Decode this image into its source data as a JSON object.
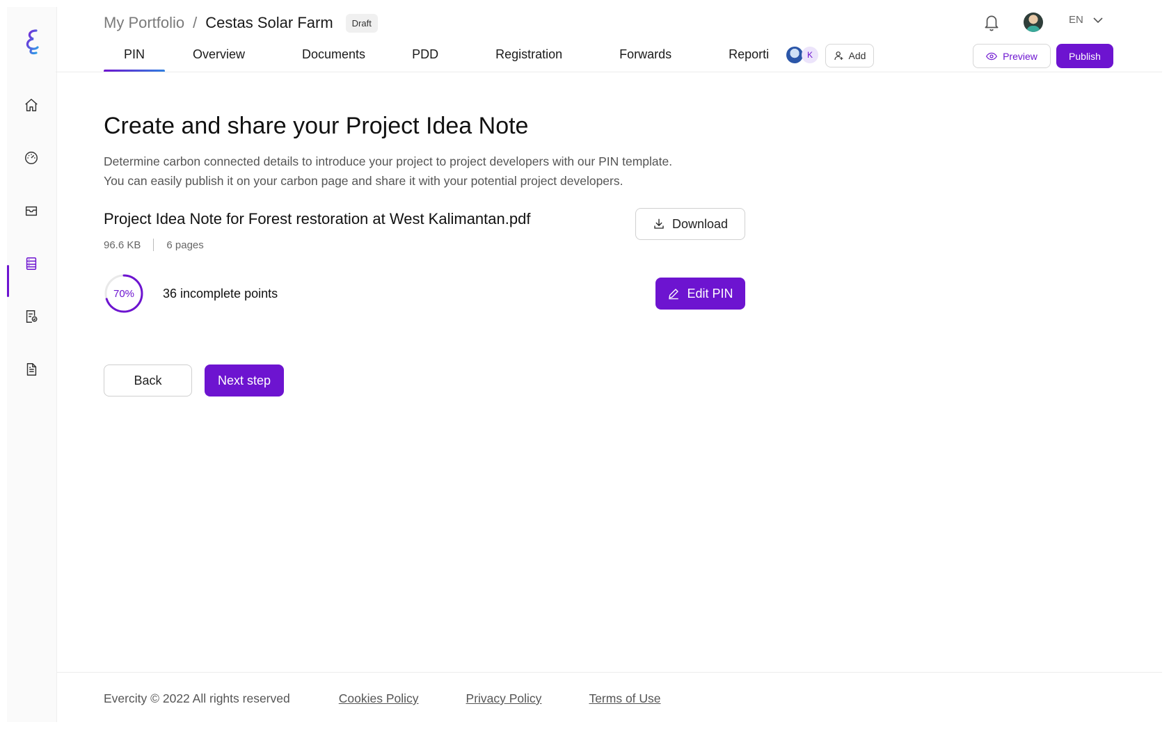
{
  "breadcrumb": {
    "root": "My Portfolio",
    "separator": "/",
    "current": "Cestas Solar Farm",
    "status": "Draft"
  },
  "header": {
    "language": "EN"
  },
  "tabs": [
    {
      "label": "PIN",
      "active": true
    },
    {
      "label": "Overview"
    },
    {
      "label": "Documents"
    },
    {
      "label": "PDD"
    },
    {
      "label": "Registration"
    },
    {
      "label": "Forwards"
    },
    {
      "label": "Reporti"
    }
  ],
  "collaborators": {
    "initial": "K",
    "add_label": "Add"
  },
  "actions": {
    "preview_label": "Preview",
    "publish_label": "Publish"
  },
  "main": {
    "title": "Create and share your Project Idea Note",
    "desc_line1": "Determine carbon connected details to introduce your project to project developers with our PIN template.",
    "desc_line2": "You can easily publish it on your carbon page and share it with your potential project developers.",
    "file": {
      "name": "Project Idea Note for Forest restoration at West Kalimantan.pdf",
      "size": "96.6 KB",
      "pages": "6 pages"
    },
    "download_label": "Download",
    "progress": {
      "percent": 70,
      "label": "70%"
    },
    "incomplete_text": "36 incomplete points",
    "edit_label": "Edit PIN",
    "back_label": "Back",
    "next_label": "Next step"
  },
  "footer": {
    "copyright": "Evercity © 2022 All rights reserved",
    "links": [
      "Cookies Policy",
      "Privacy Policy",
      "Terms of Use"
    ]
  },
  "colors": {
    "accent": "#6d14d0",
    "accent_blue": "#2f7fe0"
  },
  "sidebar": {
    "icons": [
      "home-icon",
      "dashboard-gauge-icon",
      "inbox-icon",
      "list-document-icon",
      "certificate-icon",
      "file-text-icon"
    ],
    "active_index": 3
  }
}
